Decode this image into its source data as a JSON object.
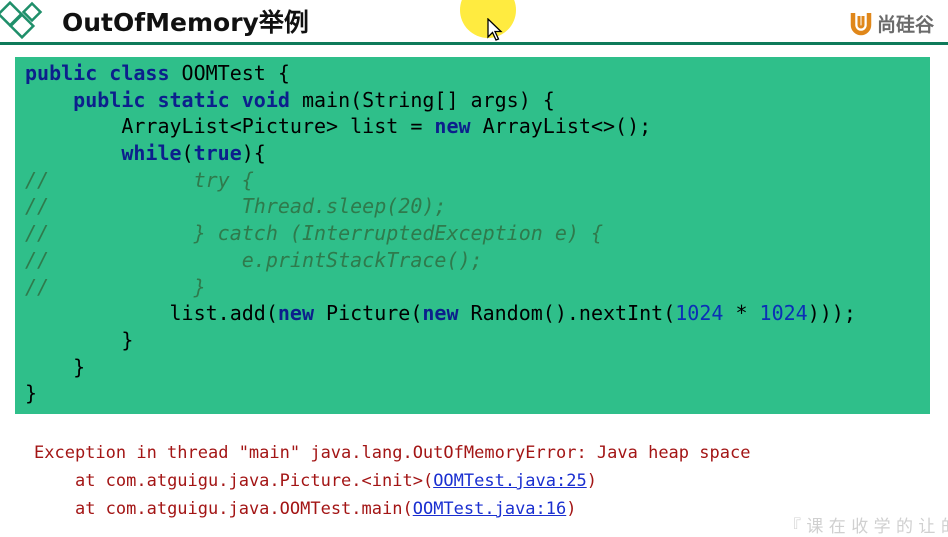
{
  "header": {
    "title": "OutOfMemory举例",
    "brand_name": "尚硅谷",
    "brand_color": "#e0871a",
    "rule_color": "#0f7a5a"
  },
  "code": {
    "background": "#2fbf8a",
    "lines": [
      [
        "public class",
        " OOMTest {"
      ],
      [
        "public static void",
        " main(String[] args) {"
      ],
      [
        "ArrayList<Picture> list = ",
        "new",
        " ArrayList<>();"
      ],
      [
        "while",
        "(",
        "true",
        "){"
      ],
      [
        "//",
        "try {"
      ],
      [
        "//",
        "Thread.sleep(20);"
      ],
      [
        "//",
        "} catch (InterruptedException e) {"
      ],
      [
        "//",
        "e.printStackTrace();"
      ],
      [
        "//",
        "}"
      ],
      [
        "list.add(",
        "new",
        " Picture(",
        "new",
        " Random().nextInt(",
        "1024",
        " * ",
        "1024",
        ")));"
      ],
      [
        "}"
      ],
      [
        "}"
      ],
      [
        "}"
      ]
    ]
  },
  "console": {
    "exception": "Exception in thread \"main\" java.lang.OutOfMemoryError: Java heap space",
    "frame1_prefix": "at com.atguigu.java.Picture.<init>(",
    "frame1_link": "OOMTest.java:25",
    "frame1_suffix": ")",
    "frame2_prefix": "at com.atguigu.java.OOMTest.main(",
    "frame2_link": "OOMTest.java:16",
    "frame2_suffix": ")"
  },
  "watermark": "『 课 在 收 学 的 让 的"
}
